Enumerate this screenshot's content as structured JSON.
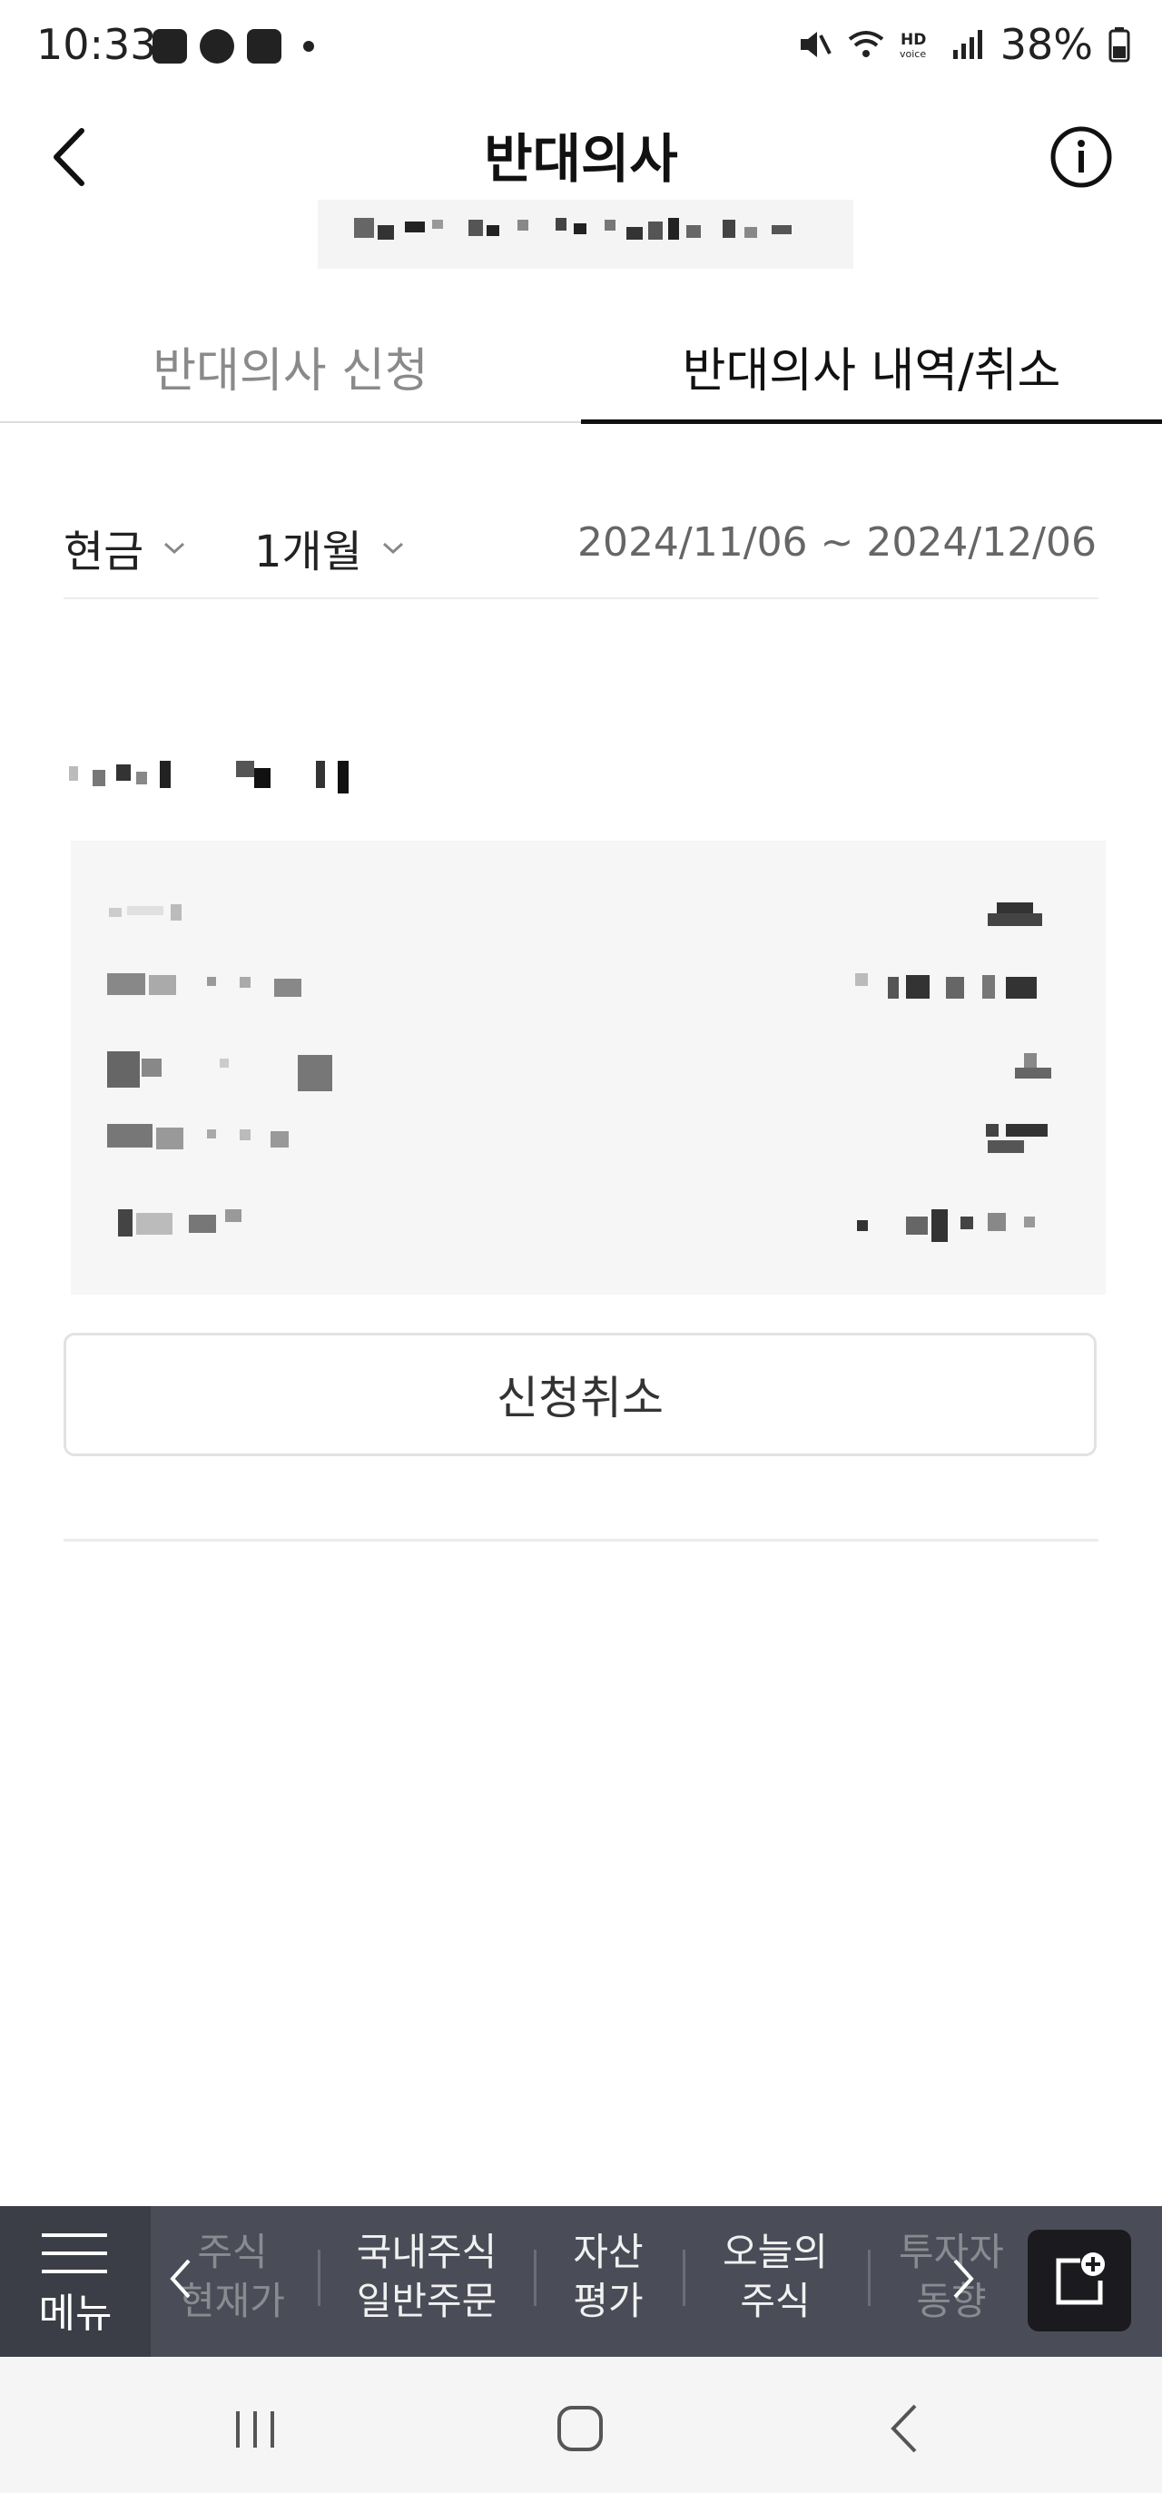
{
  "status_bar": {
    "time": "10:33",
    "left_icons": [
      "gallery-icon",
      "kakaotalk-icon",
      "youtube-icon",
      "dot-icon"
    ],
    "right_icons": [
      "mute-icon",
      "wifi-icon",
      "hd-voice-icon",
      "signal-icon",
      "battery-icon"
    ],
    "battery": "38%"
  },
  "header": {
    "title": "반대의사",
    "back_icon": "chevron-left-icon",
    "info_icon": "info-icon"
  },
  "tabs": [
    {
      "label": "반대의사 신청",
      "active": false
    },
    {
      "label": "반대의사 내역/취소",
      "active": true
    }
  ],
  "filters": {
    "type_label": "현금",
    "period_label": "1개월",
    "date_range": "2024/11/06 ~ 2024/12/06"
  },
  "record": {
    "cancel_button": "신청취소"
  },
  "bottom_menu": {
    "menu_label": "메뉴",
    "items": [
      {
        "label1": "주식",
        "label2": "현재가",
        "faded": true
      },
      {
        "label1": "국내주식",
        "label2": "일반주문",
        "faded": false
      },
      {
        "label1": "자산",
        "label2": "평가",
        "faded": false
      },
      {
        "label1": "오늘의",
        "label2": "주식",
        "faded": false
      },
      {
        "label1": "투자자",
        "label2": "동향",
        "faded": true
      }
    ]
  },
  "colors": {
    "accent": "#111111",
    "menu_bar": "#4a4d57",
    "card_bg": "#f6f6f6"
  }
}
